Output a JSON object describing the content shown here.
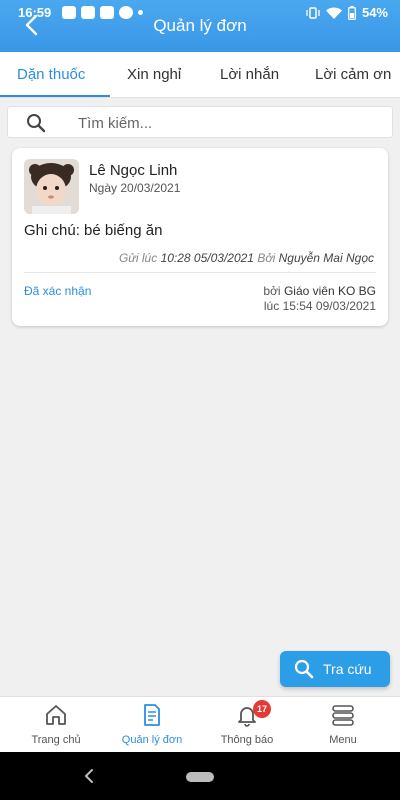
{
  "status_bar": {
    "time": "16:59",
    "battery": "54%"
  },
  "header": {
    "title": "Quản lý đơn"
  },
  "tabs": [
    {
      "label": "Dặn thuốc",
      "active": true
    },
    {
      "label": "Xin nghỉ",
      "active": false
    },
    {
      "label": "Lời nhắn",
      "active": false
    },
    {
      "label": "Lời cảm ơn",
      "active": false
    }
  ],
  "search": {
    "placeholder": "Tìm kiếm..."
  },
  "card": {
    "student_name": "Lê Ngọc Linh",
    "date": "Ngày 20/03/2021",
    "note": "Ghi chú: bé biếng ăn",
    "sent_prefix": "Gửi lúc",
    "sent_time": "10:28 05/03/2021",
    "sent_by_label": "Bởi",
    "sent_by": "Nguyễn Mai Ngọc",
    "status": "Đã xác nhận",
    "confirm_by_label": "bởi",
    "confirm_by": "Giáo viên KO BG",
    "confirm_time": "lúc 15:54 09/03/2021"
  },
  "fab": {
    "label": "Tra cứu"
  },
  "bottom_nav": [
    {
      "label": "Trang chủ",
      "icon": "home-icon",
      "active": false
    },
    {
      "label": "Quản lý đơn",
      "icon": "document-icon",
      "active": true
    },
    {
      "label": "Thông báo",
      "icon": "bell-icon",
      "active": false,
      "badge": "17"
    },
    {
      "label": "Menu",
      "icon": "menu-icon",
      "active": false
    }
  ],
  "colors": {
    "primary": "#2d8ee0",
    "header": "#3a97e6",
    "badge": "#e53935"
  }
}
